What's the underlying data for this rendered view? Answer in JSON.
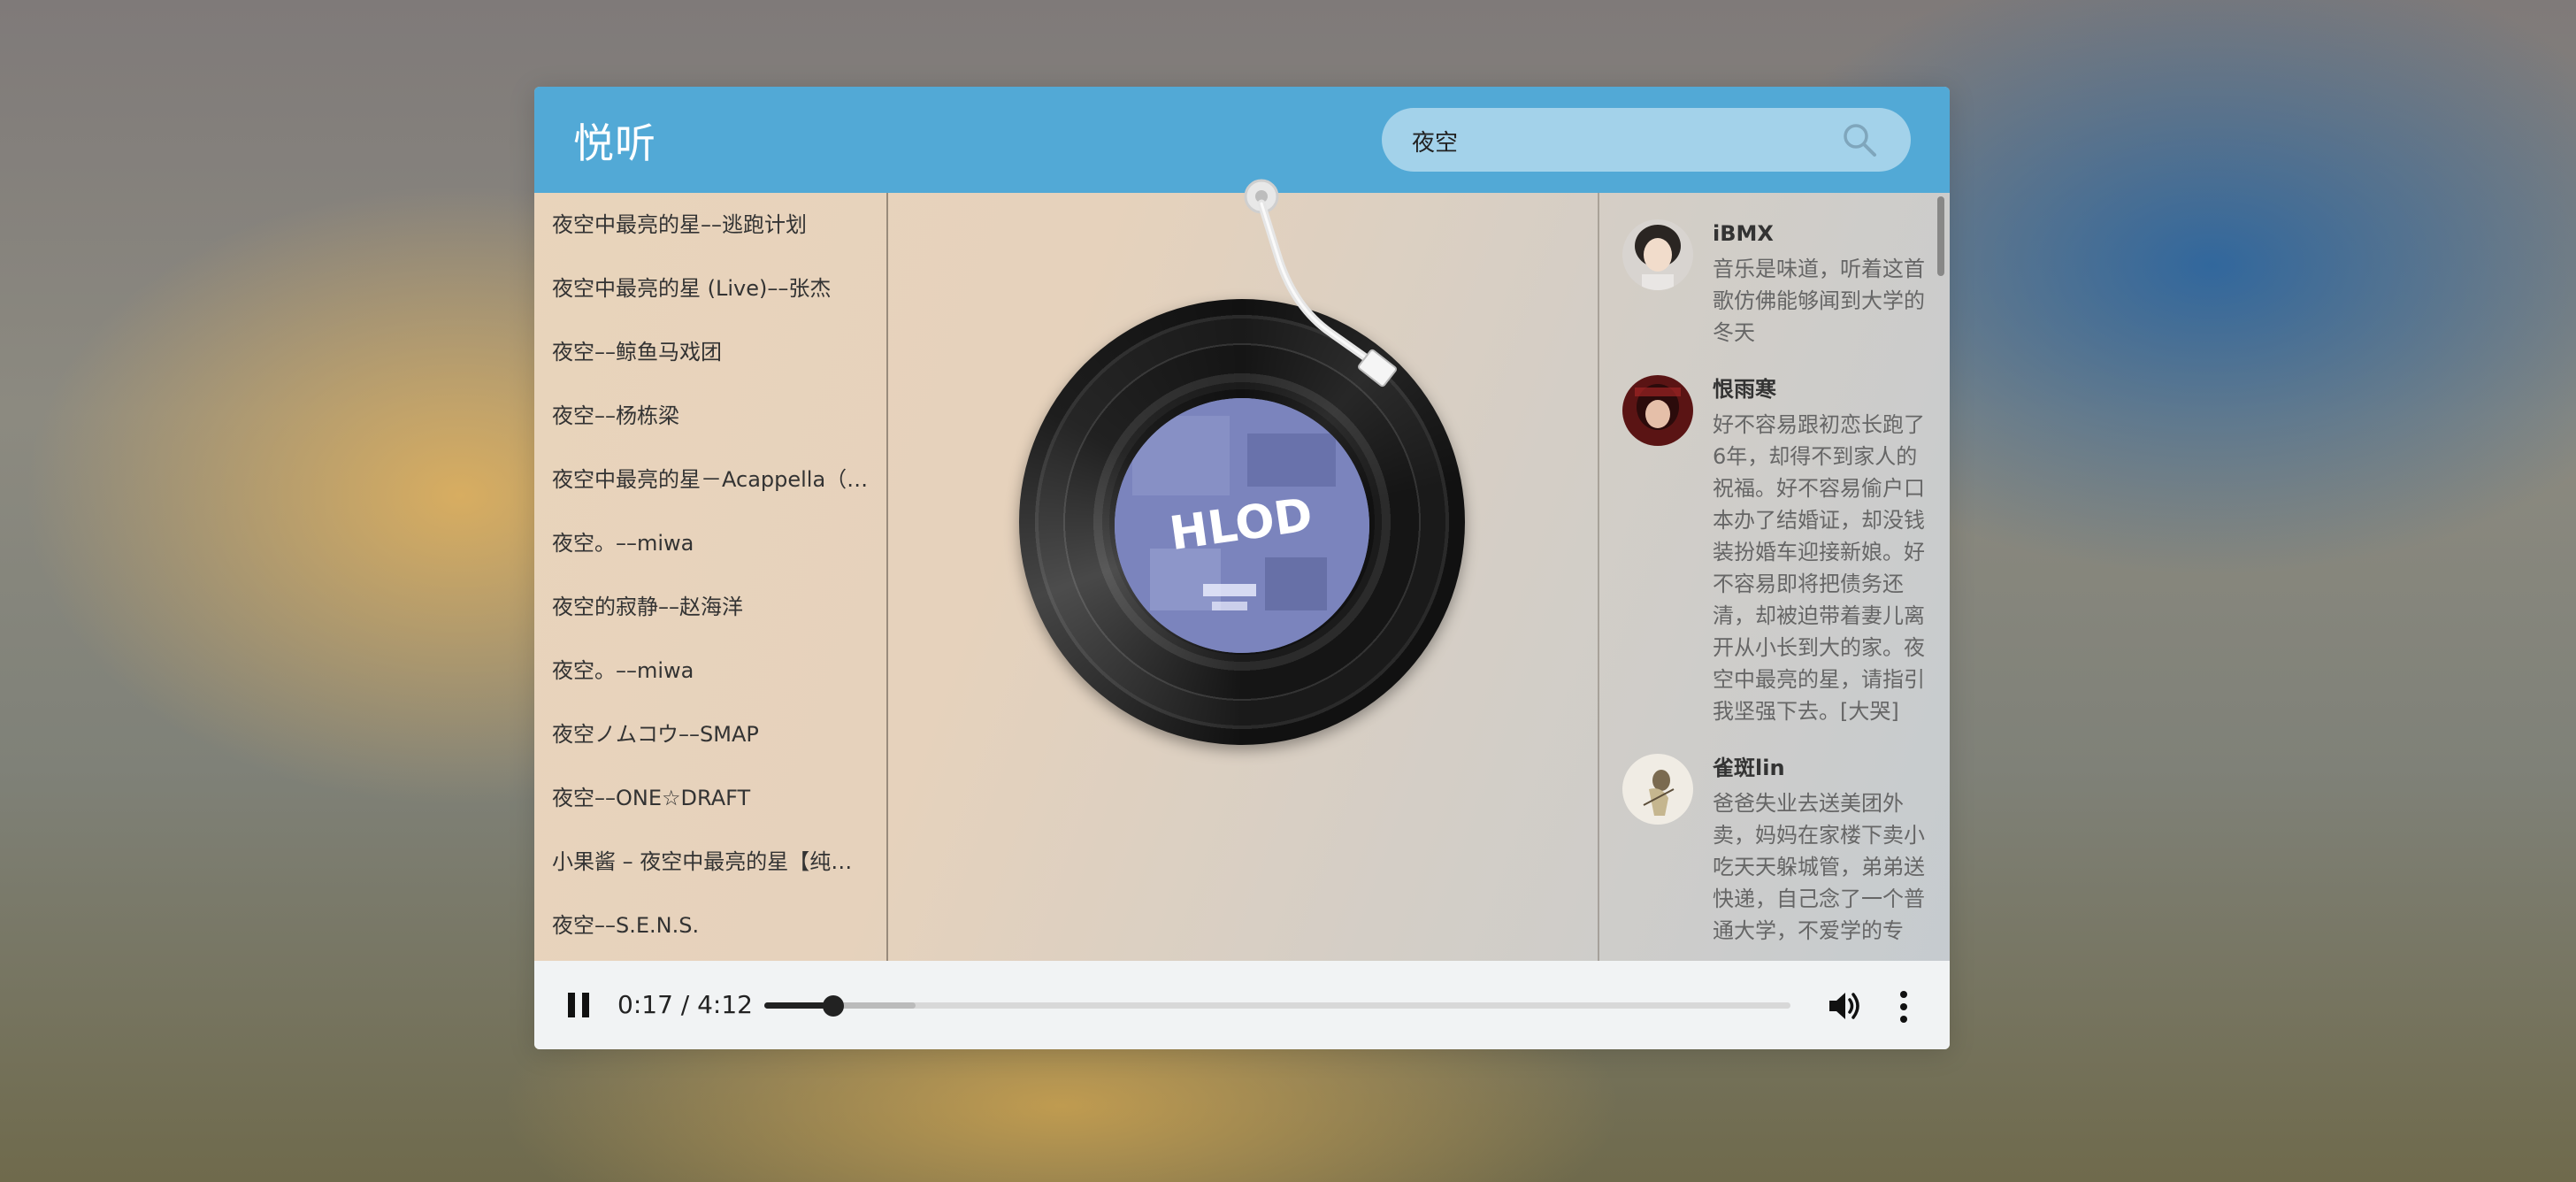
{
  "header": {
    "logo": "悦听",
    "search": {
      "value": "夜空",
      "placeholder": ""
    }
  },
  "songs": [
    "夜空中最亮的星––逃跑计划",
    "夜空中最亮的星 (Live)––张杰",
    "夜空––鲸鱼马戏团",
    "夜空––杨栋梁",
    "夜空中最亮的星－Acappella（…",
    "夜空。––miwa",
    "夜空的寂静––赵海洋",
    "夜空。––miwa",
    "夜空ノムコウ––SMAP",
    "夜空––ONE☆DRAFT",
    "小果酱 – 夜空中最亮的星【纯…",
    "夜空––S.E.N.S."
  ],
  "album": {
    "art_text": "HLOD"
  },
  "comments": [
    {
      "name": "iBMX",
      "text": "音乐是味道，听着这首歌仿佛能够闻到大学的冬天"
    },
    {
      "name": "恨雨寒",
      "text": "好不容易跟初恋长跑了6年，却得不到家人的祝福。好不容易偷户口本办了结婚证，却没钱装扮婚车迎接新娘。好不容易即将把债务还清，却被迫带着妻儿离开从小长到大的家。夜空中最亮的星，请指引我坚强下去。[大哭]"
    },
    {
      "name": "雀斑lin",
      "text": "爸爸失业去送美团外卖，妈妈在家楼下卖小吃天天躲城管，弟弟送快递，自己念了一个普通大学，不爱学的专"
    }
  ],
  "controls": {
    "time": "0:17 / 4:12",
    "progress": 0.0675,
    "buffered": 0.147
  },
  "colors": {
    "header": "#52a9d6",
    "search_bg": "#a3d2ea"
  }
}
